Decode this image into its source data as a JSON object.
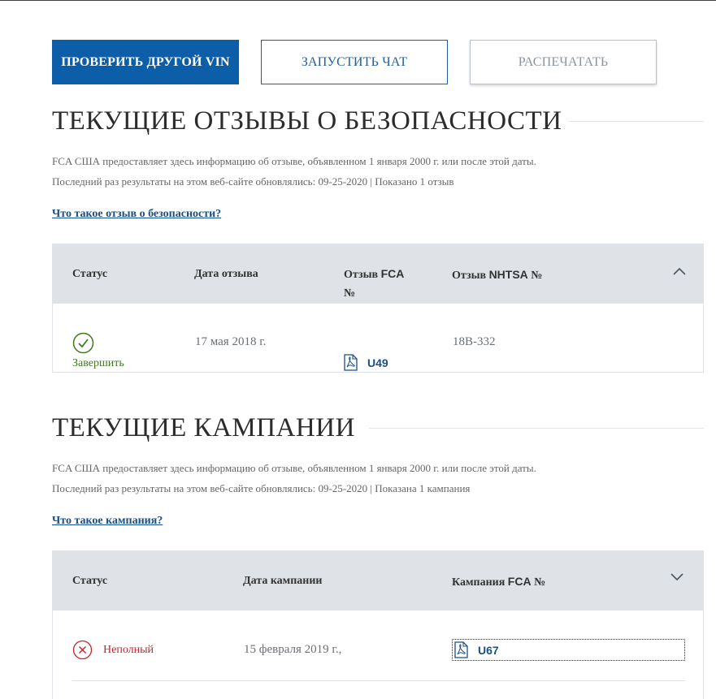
{
  "actions": {
    "check_vin": "ПРОВЕРИТЬ ДРУГОЙ VIN",
    "chat": "ЗАПУСТИТЬ ЧАТ",
    "print": "РАСПЕЧАТАТЬ"
  },
  "recalls": {
    "title": "ТЕКУЩИЕ ОТЗЫВЫ О БЕЗОПАСНОСТИ",
    "info_line1": "FCA США предоставляет здесь информацию об отзыве, объявленном 1 января 2000 г. или после этой даты.",
    "info_line2": "Последний раз результаты на этом веб-сайте обновлялись: 09-25-2020 | Показано 1 отзыв",
    "help_link": "Что такое отзыв о безопасности?",
    "columns": {
      "status": "Статус",
      "date": "Дата отзыва",
      "fca_pre": "Отзыв ",
      "fca_word": "FCA",
      "fca_no": "№",
      "nhtsa_pre": "Отзыв ",
      "nhtsa_word": "NHTSA",
      "nhtsa_no": " №"
    },
    "rows": [
      {
        "status": "Завершить",
        "date": "17 мая 2018 г.",
        "fca_id": "U49",
        "nhtsa_id": "18В-332"
      }
    ]
  },
  "campaigns": {
    "title": "ТЕКУЩИЕ КАМПАНИИ",
    "info_line1": "FCA США предоставляет здесь информацию об отзыве, объявленном 1 января 2000 г. или после этой даты.",
    "info_line2": "Последний раз результаты на этом веб-сайте обновлялись: 09-25-2020 | Показана 1 кампания",
    "help_link": "Что такое кампания?",
    "columns": {
      "status": "Статус",
      "date": "Дата кампании",
      "fca_pre": "Кампания ",
      "fca_word": "FCA",
      "fca_no": " №"
    },
    "rows": [
      {
        "status": "Неполный",
        "date": "15 февраля 2019 г.,",
        "fca_id": "U67"
      }
    ]
  },
  "colors": {
    "primary": "#0d5ea8",
    "link": "#1a4f86",
    "complete": "#3f7a1f",
    "incomplete": "#c0262c",
    "header_bg": "#dfe2e6"
  },
  "icons": {
    "complete": "check-circle-icon",
    "incomplete": "x-circle-icon",
    "pdf": "pdf-icon",
    "collapse": "chevron-up-icon",
    "expand": "chevron-down-icon"
  }
}
